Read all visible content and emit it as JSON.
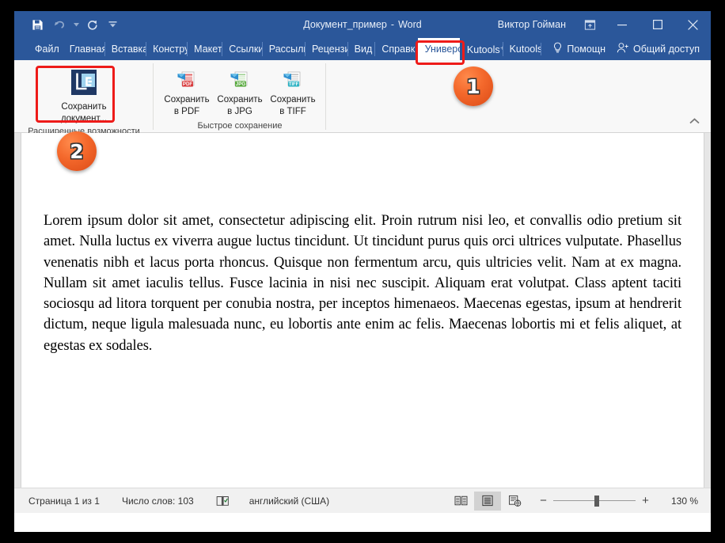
{
  "window": {
    "title": "Документ_пример",
    "app": "Word",
    "separator": "-",
    "account": "Виктор Гойман",
    "ribbon_display_icon": "ribbon-display-options-icon",
    "minimize_icon": "minimize-icon",
    "maximize_icon": "maximize-icon",
    "close_icon": "close-icon"
  },
  "quick_access": {
    "save": "save-icon",
    "undo": "undo-icon",
    "redo": "redo-icon",
    "customize": "customize-quick-access-icon"
  },
  "tabs": [
    {
      "label": "Файл",
      "active": false
    },
    {
      "label": "Главная",
      "active": false
    },
    {
      "label": "Вставка",
      "active": false
    },
    {
      "label": "Констру",
      "active": false
    },
    {
      "label": "Макет",
      "active": false
    },
    {
      "label": "Ссылки",
      "active": false
    },
    {
      "label": "Рассылк",
      "active": false
    },
    {
      "label": "Рецензи",
      "active": false
    },
    {
      "label": "Вид",
      "active": false
    },
    {
      "label": "Справка",
      "active": false
    },
    {
      "label": "Универс",
      "active": true
    },
    {
      "label": "Kutools⁺",
      "active": false
    },
    {
      "label": "Kutools",
      "active": false
    }
  ],
  "tabstrip_right": {
    "tell_me": "Помощн",
    "tell_me_icon": "lightbulb-icon",
    "share": "Общий доступ",
    "share_icon": "share-person-icon"
  },
  "ribbon": {
    "groups": [
      {
        "title": "Расширенные возможности",
        "buttons": [
          {
            "label_line1": "Сохранить",
            "label_line2": "документ...",
            "icon": "save-document-icon",
            "size": "big"
          }
        ]
      },
      {
        "title": "Быстрое сохранение",
        "buttons": [
          {
            "label_line1": "Сохранить",
            "label_line2": "в PDF",
            "icon": "save-as-pdf-icon",
            "size": "small",
            "badge": "PDF",
            "badge_color": "#d8383a"
          },
          {
            "label_line1": "Сохранить",
            "label_line2": "в JPG",
            "icon": "save-as-jpg-icon",
            "size": "small",
            "badge": "JPG",
            "badge_color": "#56a83c"
          },
          {
            "label_line1": "Сохранить",
            "label_line2": "в TIFF",
            "icon": "save-as-tiff-icon",
            "size": "small",
            "badge": "TIFF",
            "badge_color": "#2fb3c4"
          }
        ]
      }
    ],
    "collapse_icon": "collapse-ribbon-icon"
  },
  "document": {
    "body": "Lorem ipsum dolor sit amet, consectetur adipiscing elit. Proin rutrum nisi leo, et convallis odio pretium sit amet. Nulla luctus ex viverra augue luctus tincidunt. Ut tincidunt purus quis orci ultrices vulputate. Phasellus venenatis nibh et lacus porta rhoncus. Quisque non fermentum arcu, quis ultricies velit. Nam at ex magna. Nullam sit amet iaculis tellus. Fusce lacinia in nisi nec suscipit. Aliquam erat volutpat. Class aptent taciti sociosqu ad litora torquent per conubia nostra, per inceptos himenaeos. Maecenas egestas, ipsum at hendrerit dictum, neque ligula malesuada nunc, eu lobortis ante enim ac felis. Maecenas lobortis mi et felis aliquet, at egestas ex sodales."
  },
  "status_bar": {
    "page": "Страница 1 из 1",
    "words": "Число слов: 103",
    "proofing_icon": "proofing-errors-icon",
    "language": "английский (США)",
    "views": [
      {
        "name": "read-mode-view",
        "icon": "read-mode-icon",
        "selected": false
      },
      {
        "name": "print-layout-view",
        "icon": "print-layout-icon",
        "selected": true
      },
      {
        "name": "web-layout-view",
        "icon": "web-layout-icon",
        "selected": false
      }
    ],
    "zoom_out": "−",
    "zoom_in": "+",
    "zoom_value": "130 %"
  },
  "annotations": {
    "badge_1": "1",
    "badge_2": "2",
    "highlight_color": "#ee1b19"
  }
}
